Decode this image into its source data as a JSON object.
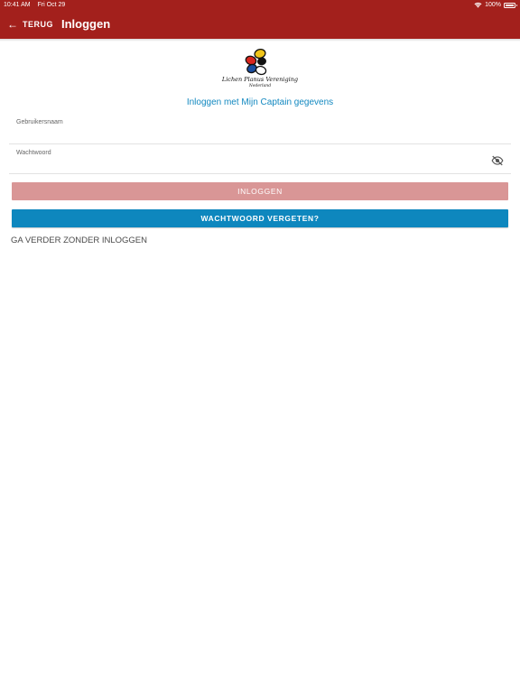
{
  "status_bar": {
    "time": "10:41 AM",
    "date": "Fri Oct 29",
    "battery": "100%",
    "icons": [
      "wifi-icon",
      "battery-icon"
    ]
  },
  "app_bar": {
    "back_label": "TERUG",
    "title": "Inloggen",
    "color": "#a3201c"
  },
  "logo": {
    "line1": "Lichen Planus Vereniging",
    "line2": "Nederland",
    "colors": [
      "#d8261f",
      "#1a4ea1",
      "#f0c419",
      "#111111"
    ]
  },
  "login": {
    "heading": "Inloggen met Mijn Captain gegevens",
    "username_label": "Gebruikersnaam",
    "username_value": "",
    "password_label": "Wachtwoord",
    "password_value": "",
    "password_toggle_icon": "eye-off-icon",
    "login_button": "INLOGGEN",
    "forgot_button": "WACHTWOORD VERGETEN?",
    "skip_link": "GA VERDER ZONDER INLOGGEN"
  },
  "colors": {
    "accent": "#1288c0",
    "login_button_disabled": "#d99696",
    "forgot_button": "#0e87be"
  }
}
